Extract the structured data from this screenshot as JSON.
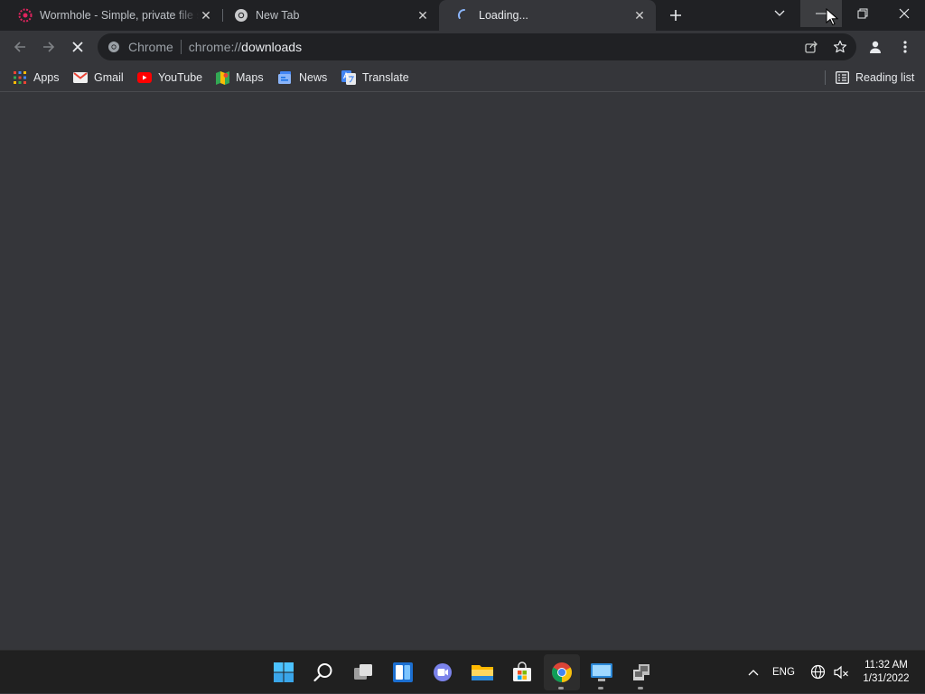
{
  "tabs": [
    {
      "title": "Wormhole - Simple, private file sharing",
      "icon": "wormhole-favicon",
      "active": false
    },
    {
      "title": "New Tab",
      "icon": "chrome-icon",
      "active": false
    },
    {
      "title": "Loading...",
      "icon": "loading-spinner-icon",
      "active": true
    }
  ],
  "omnibox": {
    "chip": "Chrome",
    "scheme": "chrome://",
    "host": "downloads"
  },
  "bookmarks": [
    {
      "label": "Apps",
      "icon": "apps-grid-icon"
    },
    {
      "label": "Gmail",
      "icon": "gmail-icon"
    },
    {
      "label": "YouTube",
      "icon": "youtube-icon"
    },
    {
      "label": "Maps",
      "icon": "maps-icon"
    },
    {
      "label": "News",
      "icon": "news-icon"
    },
    {
      "label": "Translate",
      "icon": "translate-icon"
    }
  ],
  "reading_list": "Reading list",
  "taskbar": {
    "language": "ENG",
    "time": "11:32 AM",
    "date": "1/31/2022"
  },
  "colors": {
    "frame": "#202124",
    "toolbar": "#35363a",
    "taskbar": "#202020"
  }
}
